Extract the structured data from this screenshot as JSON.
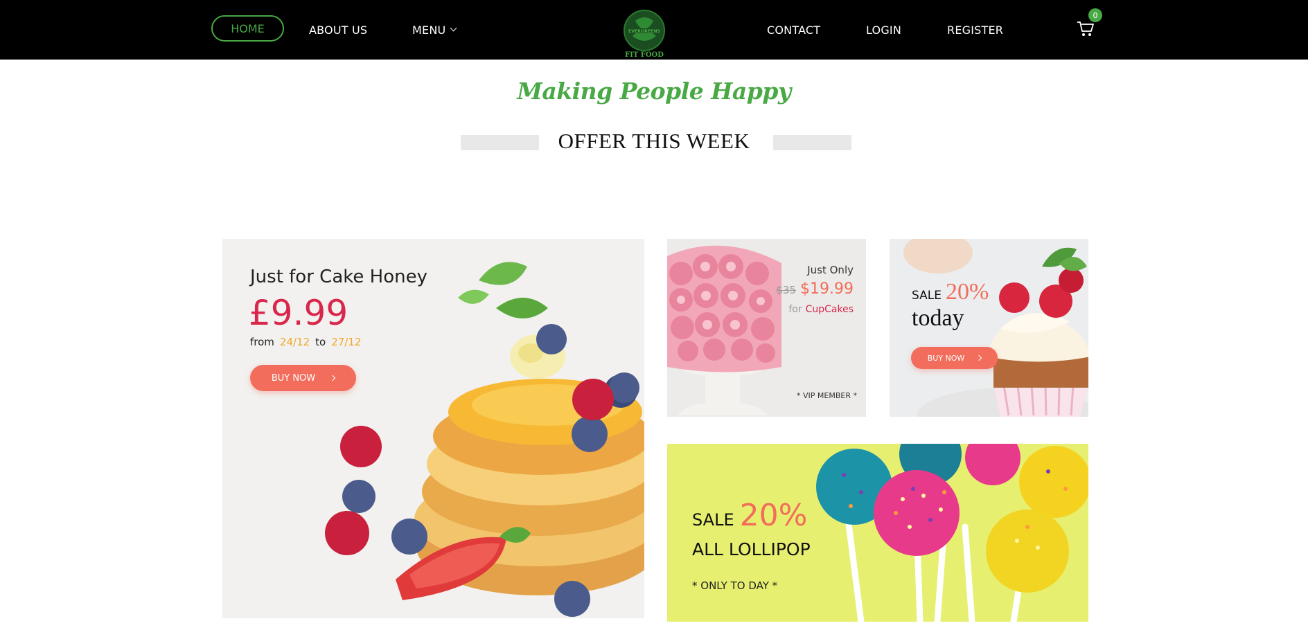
{
  "nav": {
    "home": "HOME",
    "about": "ABOUT US",
    "menu": "MENU",
    "contact": "CONTACT",
    "login": "LOGIN",
    "register": "REGISTER",
    "cart_count": "0",
    "logo_text_top": "EVERGREENS",
    "logo_text_bottom": "FIT FOOD"
  },
  "headings": {
    "tagline": "Making People Happy",
    "offer_title": "OFFER THIS WEEK"
  },
  "banner_cake": {
    "title": "Just for Cake Honey",
    "price": "£9.99",
    "from_label": "from",
    "from_date": "24/12",
    "to_label": "to",
    "to_date": "27/12",
    "button": "BUY NOW"
  },
  "banner_cupcakes": {
    "just_only": "Just Only",
    "old_price": "$35",
    "new_price": "$19.99",
    "for_label": "for",
    "product": "CupCakes",
    "note": "* VIP MEMBER *"
  },
  "banner_sale": {
    "sale_label": "SALE",
    "percent": "20%",
    "today": "today",
    "button": "BUY NOW"
  },
  "banner_lollipop": {
    "sale_label": "SALE",
    "percent": "20%",
    "title": "ALL LOLLIPOP",
    "note": "* ONLY TO DAY *"
  },
  "colors": {
    "brand_green": "#49a945",
    "price_red": "#d9264b",
    "coral": "#f26d5b",
    "date_yellow": "#f0a726",
    "lollipop_bg": "#e6ef6f"
  },
  "icons": [
    "cart-icon",
    "chevron-down-icon",
    "arrow-right-icon"
  ]
}
